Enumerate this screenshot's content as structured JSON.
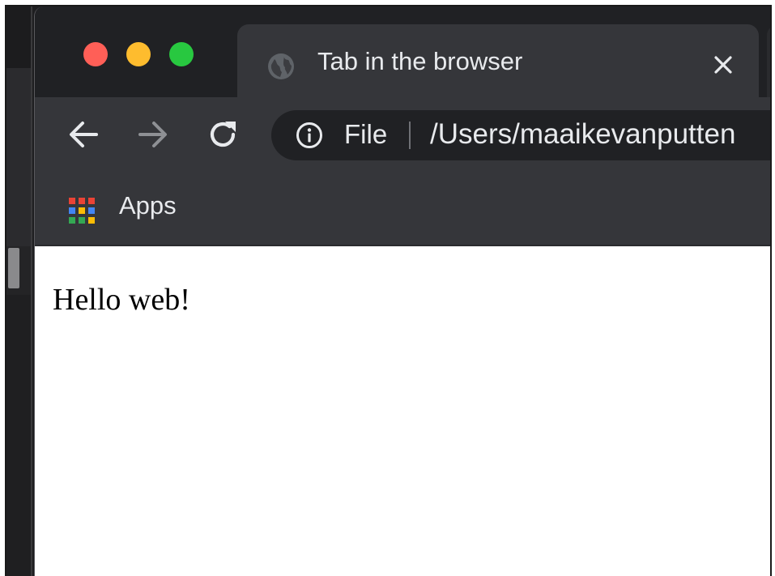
{
  "tab": {
    "title": "Tab in the browser",
    "favicon": "globe-icon",
    "close_icon": "close-icon"
  },
  "window_controls": {
    "close_color": "#ff5f57",
    "minimize_color": "#febc2e",
    "zoom_color": "#28c840"
  },
  "toolbar": {
    "back_icon": "arrow-left-icon",
    "forward_icon": "arrow-right-icon",
    "reload_icon": "reload-icon",
    "forward_enabled": false
  },
  "omnibox": {
    "info_icon": "info-icon",
    "scheme_chip": "File",
    "url": "/Users/maaikevanputten"
  },
  "bookmarks": {
    "items": [
      {
        "label": "Apps",
        "icon": "apps-grid-icon"
      }
    ]
  },
  "page": {
    "body_text": "Hello web!"
  },
  "colors": {
    "chrome_dark": "#202124",
    "toolbar": "#35363a",
    "text_light": "#e8eaed",
    "disabled_icon": "#8e9094"
  }
}
